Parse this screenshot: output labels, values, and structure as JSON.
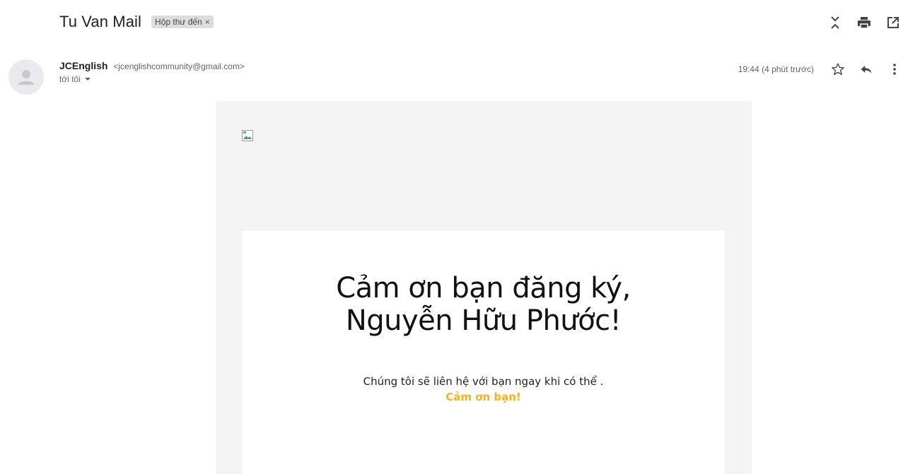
{
  "subject": {
    "title": "Tu Van Mail",
    "label": "Hộp thư đến",
    "label_close": "×"
  },
  "header_actions": [
    {
      "name": "collapse-all-icon"
    },
    {
      "name": "print-icon"
    },
    {
      "name": "open-in-new-window-icon"
    }
  ],
  "sender": {
    "name": "JCEnglish",
    "email": "<jcenglishcommunity@gmail.com>",
    "to": "tới tôi"
  },
  "meta": {
    "timestamp": "19:44 (4 phút trước)",
    "actions": [
      {
        "name": "star-icon"
      },
      {
        "name": "reply-icon"
      },
      {
        "name": "more-vert-icon"
      }
    ]
  },
  "body": {
    "headline_line1": "Cảm ơn bạn đăng ký,",
    "headline_line2": "Nguyễn Hữu Phước!",
    "message": "Chúng tôi sẽ liên hệ với bạn ngay khi có thể .",
    "thanks": "Cảm ơn bạn!"
  },
  "colors": {
    "accent": "#f5b21a",
    "body_bg": "#f4f4f4",
    "chip_bg": "#dddddd"
  }
}
